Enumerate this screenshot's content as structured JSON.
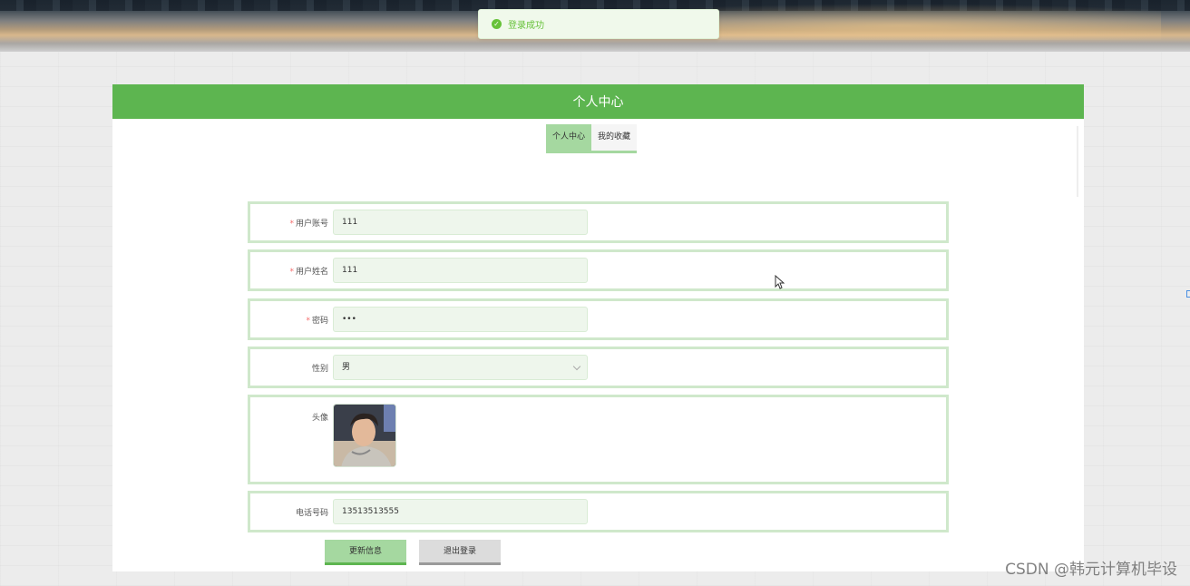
{
  "toast": {
    "text": "登录成功",
    "icon": "check-circle-icon",
    "color": "#67c23a"
  },
  "header": {
    "title": "个人中心",
    "color": "#5db550"
  },
  "tabs": [
    {
      "label": "个人中心",
      "active": true
    },
    {
      "label": "我的收藏",
      "active": false
    }
  ],
  "form": {
    "account": {
      "label": "用户账号",
      "required": "*",
      "value": "111"
    },
    "name": {
      "label": "用户姓名",
      "required": "*",
      "value": "111"
    },
    "password": {
      "label": "密码",
      "required": "*",
      "value": "•••"
    },
    "gender": {
      "label": "性别",
      "value": "男"
    },
    "avatar": {
      "label": "头像"
    },
    "phone": {
      "label": "电话号码",
      "value": "13513513555"
    }
  },
  "buttons": {
    "update": "更新信息",
    "logout": "退出登录"
  },
  "watermark": "CSDN @韩元计算机毕设"
}
